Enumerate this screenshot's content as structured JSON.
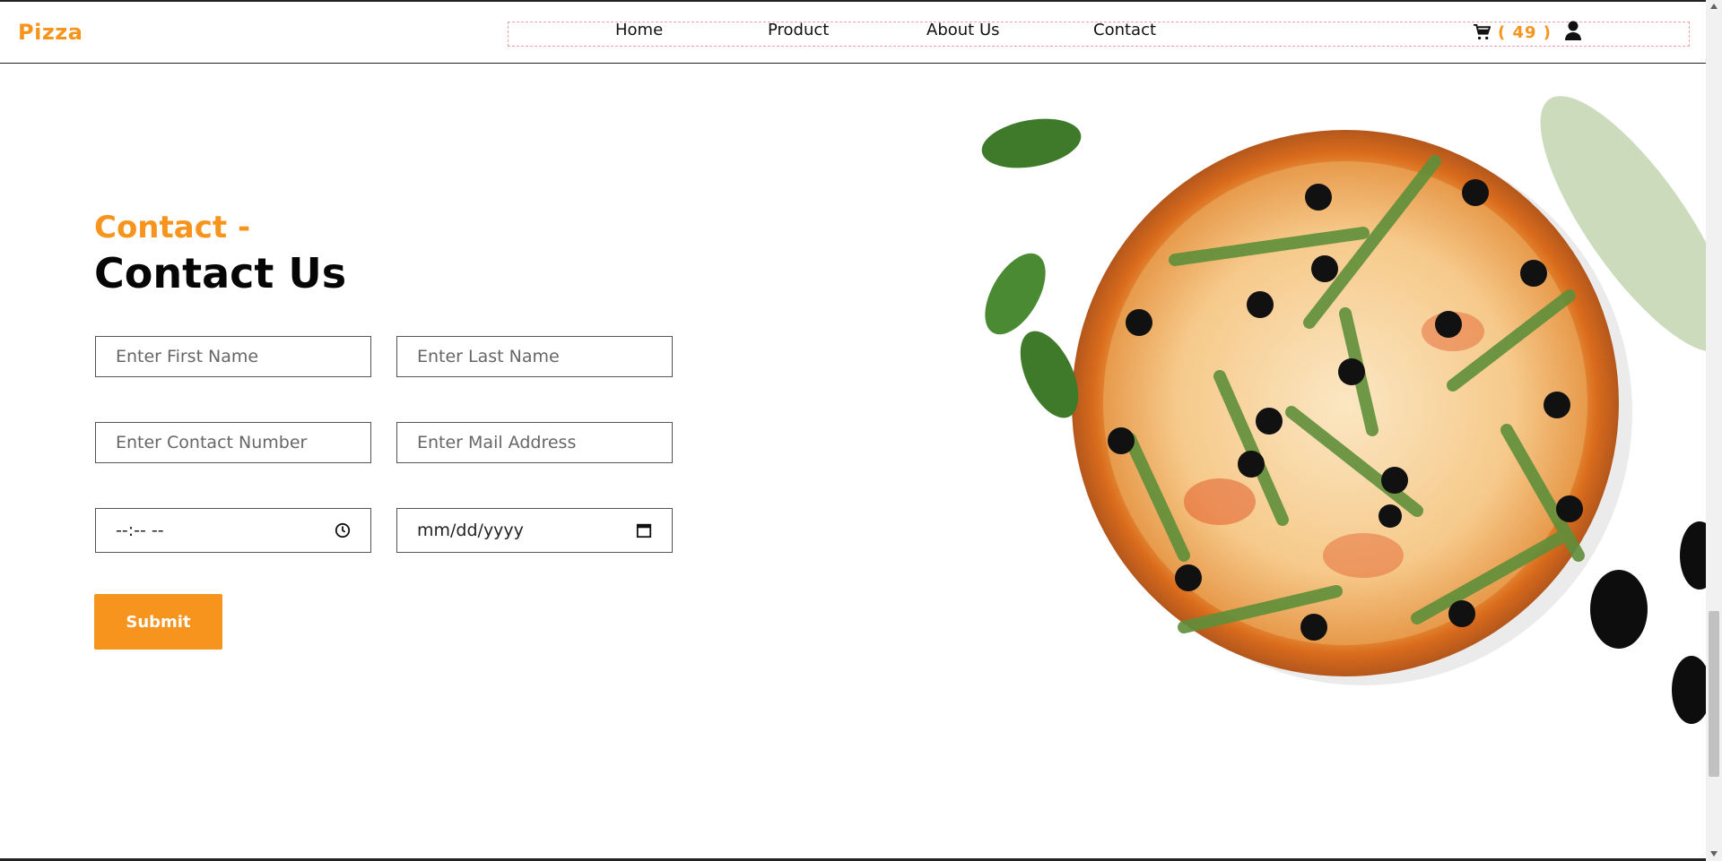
{
  "brand": "Pizza",
  "nav": {
    "items": [
      "Home",
      "Product",
      "About Us",
      "Contact"
    ],
    "cart_count": "( 49 )"
  },
  "hero": {
    "eyebrow": "Contact -",
    "title": "Contact Us"
  },
  "form": {
    "first_name_placeholder": "Enter First Name",
    "last_name_placeholder": "Enter Last Name",
    "contact_number_placeholder": "Enter Contact Number",
    "mail_placeholder": "Enter Mail Address",
    "time_value": "--:-- --",
    "date_value": "mm/dd/yyyy",
    "submit_label": "Submit"
  },
  "colors": {
    "accent": "#f7941d",
    "text": "#111111",
    "background": "#ffffff"
  },
  "icons": {
    "cart": "cart-icon",
    "user": "user-icon",
    "clock": "clock-icon",
    "calendar": "calendar-icon"
  }
}
